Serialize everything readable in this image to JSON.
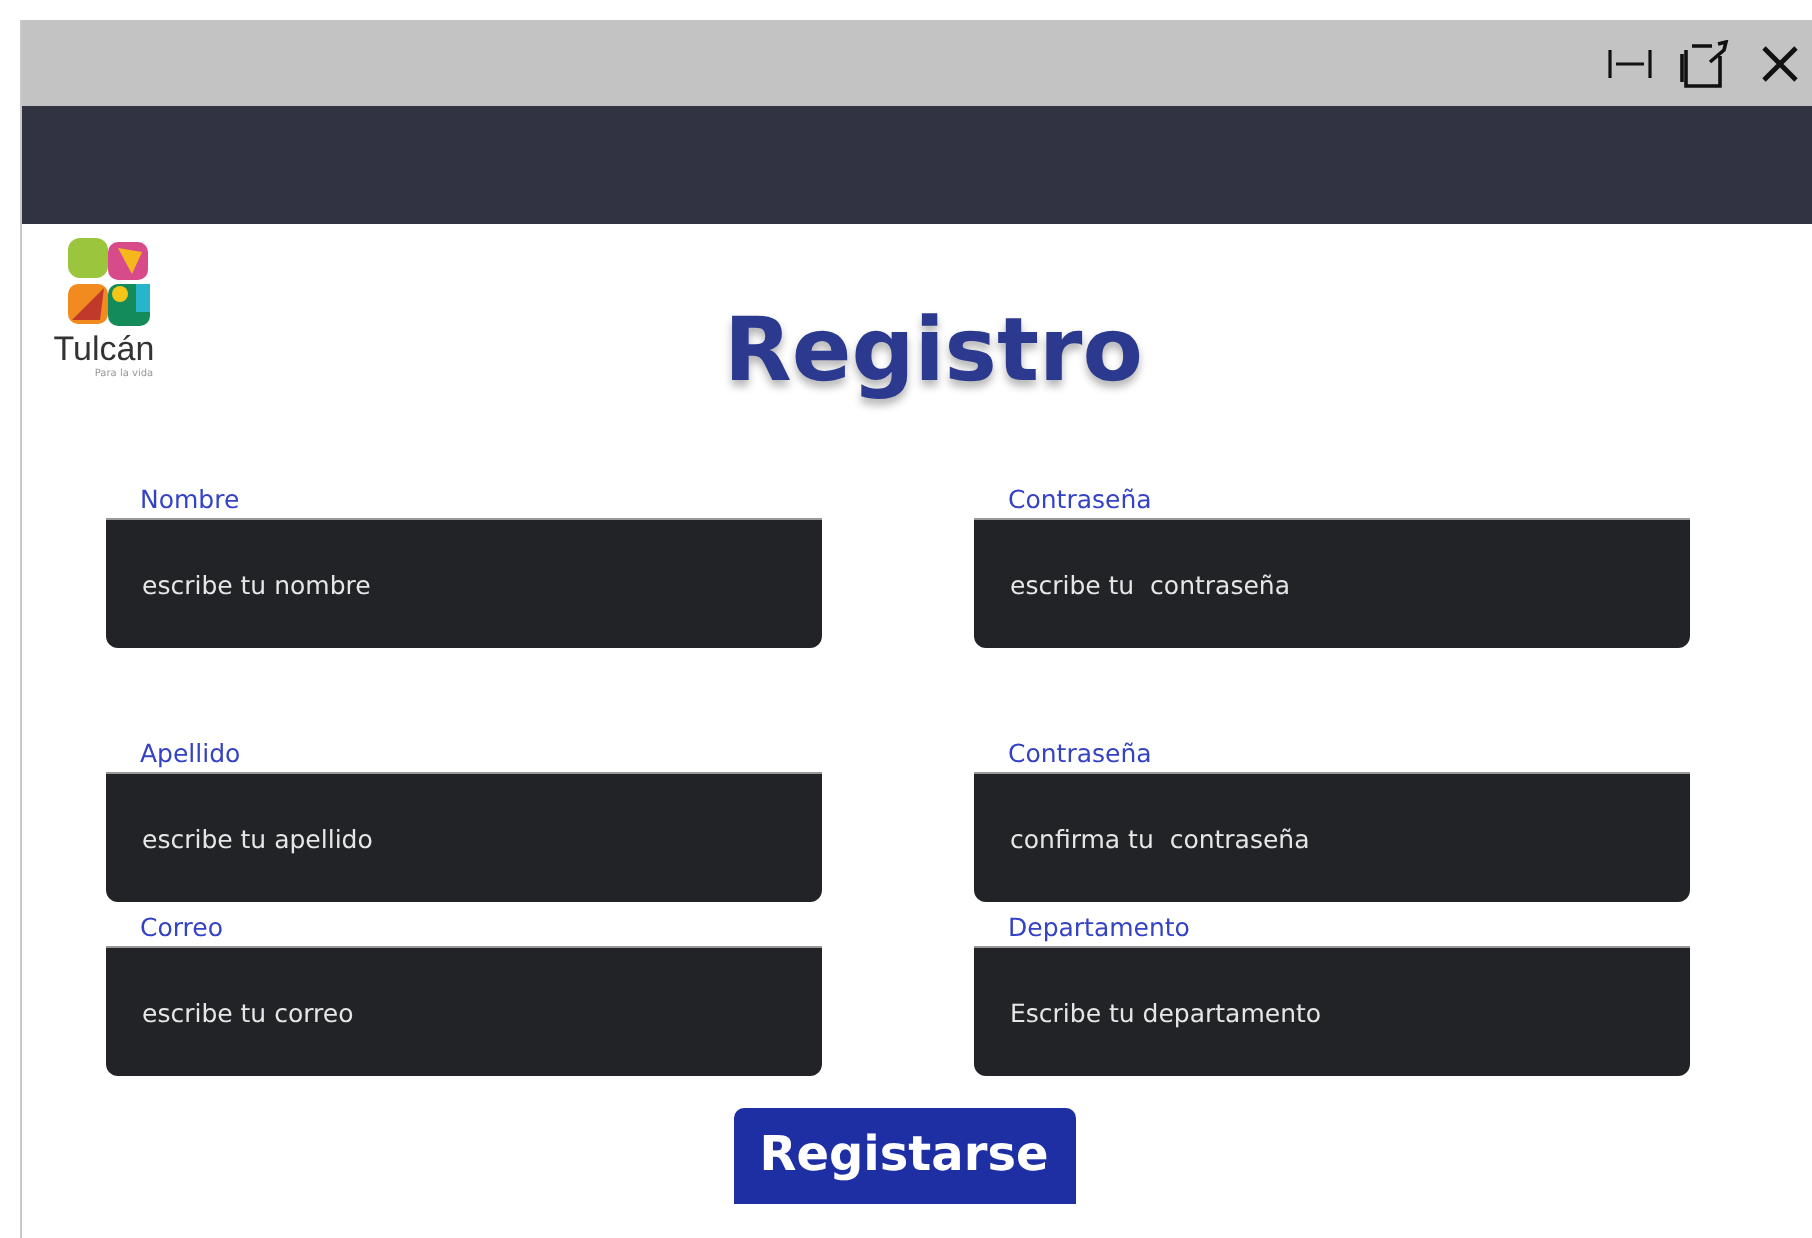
{
  "logo": {
    "name": "Tulcán",
    "tagline": "Para la vida"
  },
  "title": "Registro",
  "fields": [
    {
      "label": "Nombre",
      "placeholder": "escribe tu nombre"
    },
    {
      "label": "Contraseña",
      "placeholder": "escribe tu  contraseña"
    },
    {
      "label": "Apellido",
      "placeholder": "escribe tu apellido"
    },
    {
      "label": "Contraseña",
      "placeholder": "confirma tu  contraseña"
    },
    {
      "label": "Correo",
      "placeholder": "escribe tu correo"
    },
    {
      "label": "Departamento",
      "placeholder": "Escribe tu departamento"
    }
  ],
  "submit": "Registarse"
}
